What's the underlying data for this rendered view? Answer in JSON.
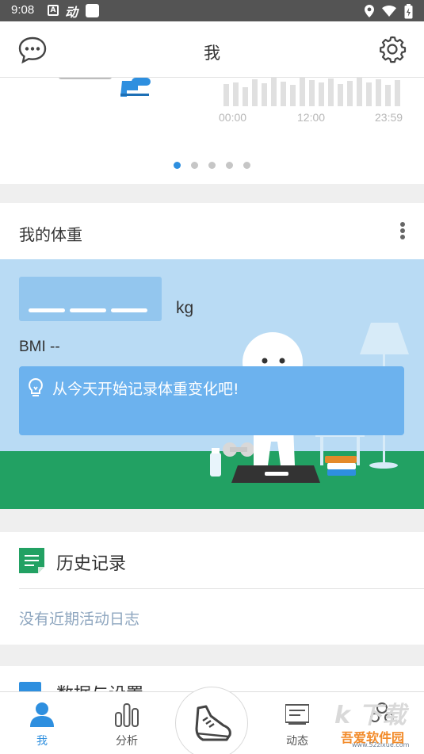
{
  "status_bar": {
    "time": "9:08",
    "icons": [
      "a-box-icon",
      "dong-icon",
      "square-icon",
      "location-icon",
      "wifi-icon",
      "battery-charging-icon"
    ]
  },
  "header": {
    "title": "我",
    "left_icon": "message-bubble-icon",
    "right_icon": "gear-icon"
  },
  "carousel": {
    "axis_labels": [
      "00:00",
      "12:00",
      "23:59"
    ],
    "page_count": 5,
    "active_page": 1
  },
  "weight_card": {
    "title": "我的体重",
    "unit": "kg",
    "bmi": "BMI --",
    "tip": "从今天开始记录体重变化吧!"
  },
  "history": {
    "title": "历史记录",
    "empty_text": "没有近期活动日志"
  },
  "data_settings": {
    "title": "数据与设置"
  },
  "bottom_nav": {
    "items": [
      {
        "label": "我",
        "icon": "person-icon",
        "active": true
      },
      {
        "label": "分析",
        "icon": "bar-chart-icon",
        "active": false
      },
      {
        "label": "",
        "icon": "shoe-icon",
        "active": false
      },
      {
        "label": "动态",
        "icon": "feed-icon",
        "active": false
      },
      {
        "label": "",
        "icon": "community-icon",
        "active": false
      }
    ]
  },
  "watermark": {
    "big": "k 下载",
    "main": "吾爱软件园",
    "sub": "www.52zixue.com"
  },
  "colors": {
    "accent": "#2e8fdf",
    "sky": "#b9dbf4",
    "grass": "#22a163",
    "tip_bg": "#6cb2ee"
  }
}
